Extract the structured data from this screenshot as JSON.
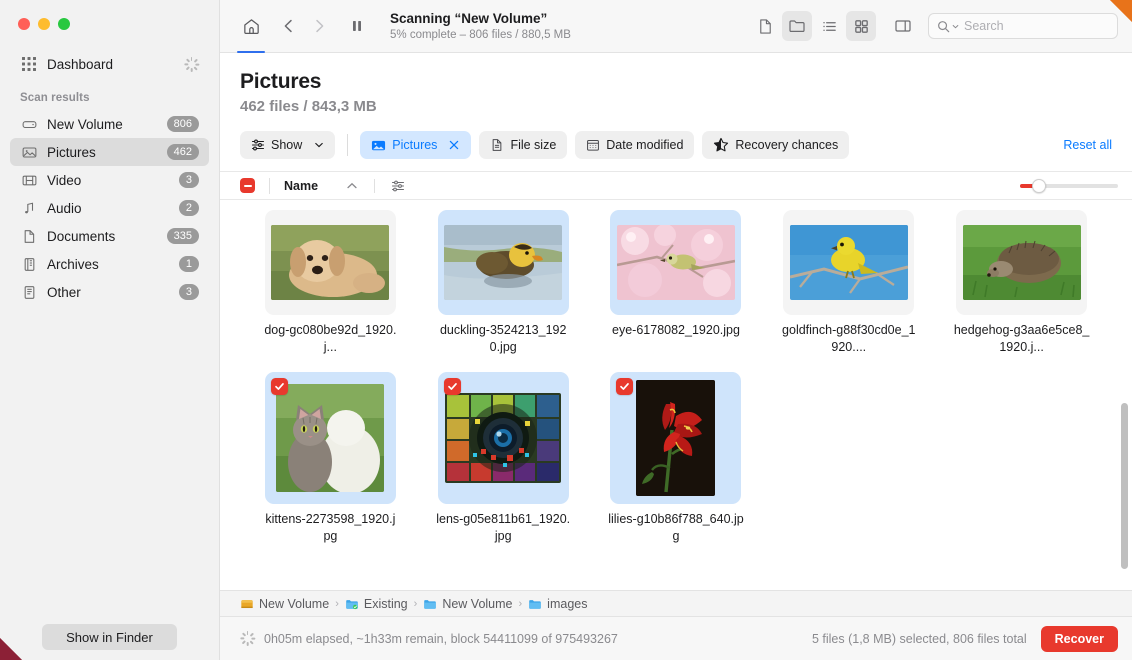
{
  "sidebar": {
    "dashboard": {
      "label": "Dashboard",
      "icon": "grid-icon"
    },
    "section_label": "Scan results",
    "items": [
      {
        "label": "New Volume",
        "badge": "806",
        "icon": "drive-icon",
        "active": false
      },
      {
        "label": "Pictures",
        "badge": "462",
        "icon": "photo-icon",
        "active": true
      },
      {
        "label": "Video",
        "badge": "3",
        "icon": "film-icon",
        "active": false
      },
      {
        "label": "Audio",
        "badge": "2",
        "icon": "music-icon",
        "active": false
      },
      {
        "label": "Documents",
        "badge": "335",
        "icon": "doc-icon",
        "active": false
      },
      {
        "label": "Archives",
        "badge": "1",
        "icon": "archive-icon",
        "active": false
      },
      {
        "label": "Other",
        "badge": "3",
        "icon": "other-icon",
        "active": false
      }
    ],
    "finder_button": "Show in Finder"
  },
  "toolbar": {
    "home_icon": "home-icon",
    "back_icon": "chevron-left-icon",
    "forward_icon": "chevron-right-icon",
    "pause_icon": "pause-icon",
    "scan_title": "Scanning “New Volume”",
    "scan_subtitle": "5% complete – 806 files / 880,5 MB",
    "view_icons": [
      {
        "name": "file-view-icon",
        "selected": false
      },
      {
        "name": "folder-view-icon",
        "selected": true
      },
      {
        "name": "list-view-icon",
        "selected": false
      },
      {
        "name": "grid-view-icon",
        "selected": true
      },
      {
        "name": "preview-pane-icon",
        "selected": false
      }
    ],
    "search": {
      "placeholder": "Search",
      "value": "",
      "icon": "search-icon"
    }
  },
  "header": {
    "title": "Pictures",
    "subtitle": "462 files / 843,3 MB"
  },
  "filters": {
    "show": {
      "label": "Show",
      "icon": "sliders-icon",
      "chevron": "chevron-down-icon"
    },
    "chips": [
      {
        "label": "Pictures",
        "icon": "photo-icon",
        "active": true,
        "closable": true
      },
      {
        "label": "File size",
        "icon": "doc-icon",
        "active": false,
        "closable": false
      },
      {
        "label": "Date modified",
        "icon": "calendar-icon",
        "active": false,
        "closable": false
      },
      {
        "label": "Recovery chances",
        "icon": "star-half-icon",
        "active": false,
        "closable": false
      }
    ],
    "reset": "Reset all"
  },
  "columnbar": {
    "select_all_state": "indeterminate",
    "name_label": "Name",
    "sort_icon": "chevron-up-icon",
    "filter_icon": "sliders-icon",
    "zoom_value": 14
  },
  "grid": {
    "rows": [
      [
        {
          "filename": "dog-gc080be92d_1920.j...",
          "selected": false,
          "checked": false,
          "orientation": "landscape",
          "subject": "golden-retriever-puppy"
        },
        {
          "filename": "duckling-3524213_1920.jpg",
          "selected": true,
          "checked": false,
          "orientation": "landscape",
          "subject": "duckling-on-water"
        },
        {
          "filename": "eye-6178082_1920.jpg",
          "selected": true,
          "checked": false,
          "orientation": "landscape",
          "subject": "bird-on-blossom-branch"
        },
        {
          "filename": "goldfinch-g88f30cd0e_1920....",
          "selected": false,
          "checked": false,
          "orientation": "landscape",
          "subject": "yellow-finch-on-branch"
        },
        {
          "filename": "hedgehog-g3aa6e5ce8_1920.j...",
          "selected": false,
          "checked": false,
          "orientation": "landscape",
          "subject": "hedgehog-in-grass"
        }
      ],
      [
        {
          "filename": "kittens-2273598_1920.jpg",
          "selected": true,
          "checked": true,
          "orientation": "square",
          "subject": "two-kittens"
        },
        {
          "filename": "lens-g05e811b61_1920.jpg",
          "selected": true,
          "checked": true,
          "orientation": "landscape",
          "subject": "camera-lens-color-wheel"
        },
        {
          "filename": "lilies-g10b86f788_640.jpg",
          "selected": true,
          "checked": true,
          "orientation": "portrait",
          "subject": "red-lilies"
        }
      ]
    ]
  },
  "breadcrumb": [
    {
      "label": "New Volume",
      "icon": "drive-icon"
    },
    {
      "label": "Existing",
      "icon": "folder-sync-icon"
    },
    {
      "label": "New Volume",
      "icon": "folder-icon"
    },
    {
      "label": "images",
      "icon": "folder-icon"
    }
  ],
  "status": {
    "progress_text": "0h05m elapsed, ~1h33m remain, block 54411099 of 975493267",
    "selection_text": "5 files (1,8 MB) selected, 806 files total",
    "recover_button": "Recover"
  },
  "colors": {
    "accent_red": "#e8392d",
    "accent_blue": "#0a7bff",
    "chip_active_bg": "#d3e7ff",
    "tile_selected_bg": "#cfe4fb",
    "corner_orange": "#e8731a",
    "corner_maroon": "#8c2036"
  }
}
